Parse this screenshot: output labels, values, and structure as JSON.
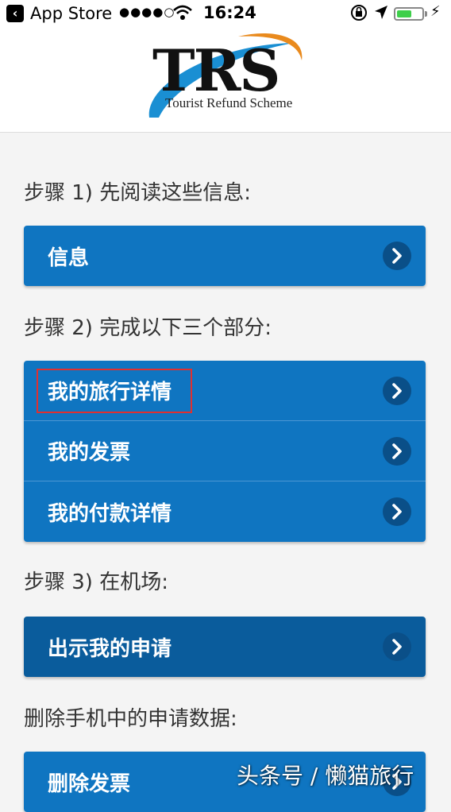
{
  "status_bar": {
    "back_app": "App Store",
    "signal": "●●●●○",
    "time": "16:24",
    "battery_level": 0.6
  },
  "header": {
    "logo_word": "TRS",
    "logo_tagline": "Tourist Refund Scheme"
  },
  "steps": [
    {
      "label": "步骤 1) 先阅读这些信息:"
    },
    {
      "label": "步骤 2) 完成以下三个部分:"
    },
    {
      "label": "步骤 3) 在机场:"
    },
    {
      "label": "删除手机中的申请数据:"
    }
  ],
  "buttons": {
    "info": "信息",
    "travel_details": "我的旅行详情",
    "invoices": "我的发票",
    "payment_details": "我的付款详情",
    "show_application": "出示我的申请",
    "delete_invoices": "删除发票"
  },
  "watermark": "头条号 / 懒猫旅行",
  "colors": {
    "button_blue": "#0f75c1",
    "button_dark_blue": "#0a5c9c",
    "highlight_red": "#e0302f",
    "battery_green": "#3ecf4a"
  }
}
